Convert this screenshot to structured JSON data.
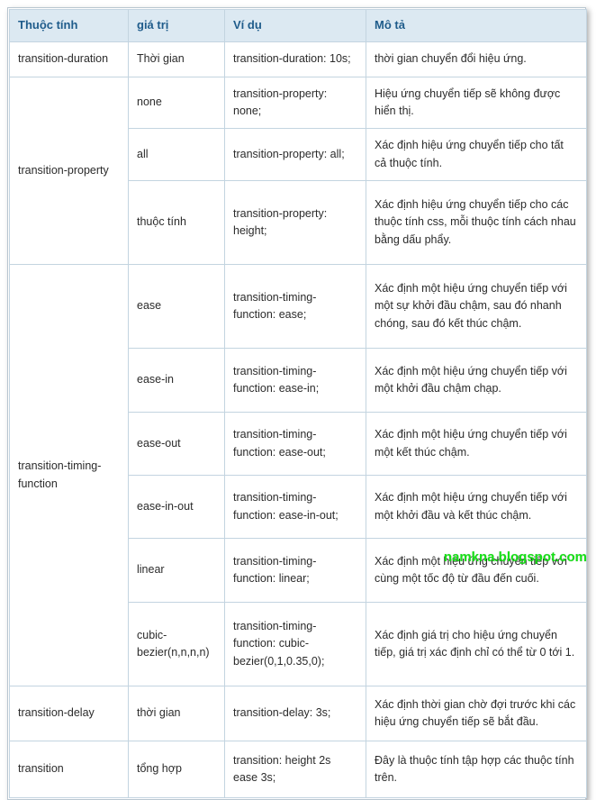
{
  "table": {
    "headers": [
      {
        "label": "Thuộc tính"
      },
      {
        "label": "giá trị"
      },
      {
        "label": "Ví dụ"
      },
      {
        "label": "Mô tả"
      }
    ],
    "rows": [
      {
        "property": "transition-duration",
        "value": "Thời gian",
        "example": "transition-duration: 10s;",
        "description": "thời gian chuyển đổi hiệu ứng."
      },
      {
        "property": "transition-property",
        "value": "none",
        "example": "transition-property: none;",
        "description": "Hiệu ứng chuyển tiếp sẽ không được hiển thị."
      },
      {
        "property": "",
        "value": "all",
        "example": "transition-property: all;",
        "description": "Xác định hiệu ứng chuyển tiếp cho tất cả thuộc tính."
      },
      {
        "property": "",
        "value": "thuộc tính",
        "example": "transition-property: height;",
        "description": "Xác định hiệu ứng chuyển tiếp cho các thuộc tính css, mỗi thuộc tính cách nhau bằng dấu phẩy."
      },
      {
        "property": "transition-timing-function",
        "value": "ease",
        "example": "transition-timing-function: ease;",
        "description": "Xác định một hiệu ứng chuyển tiếp với một sự khởi đầu chậm, sau đó nhanh chóng, sau đó kết thúc chậm."
      },
      {
        "property": "",
        "value": "ease-in",
        "example": "transition-timing-function: ease-in;",
        "description": "Xác định một hiệu ứng chuyển tiếp với một khởi đầu chậm chạp."
      },
      {
        "property": "",
        "value": "ease-out",
        "example": "transition-timing-function: ease-out;",
        "description": "Xác định một hiệu ứng chuyển tiếp với một kết thúc chậm."
      },
      {
        "property": "",
        "value": "ease-in-out",
        "example": "transition-timing-function: ease-in-out;",
        "description": "Xác định một hiệu ứng chuyển tiếp với một khởi đầu và kết thúc chậm."
      },
      {
        "property": "",
        "value": "linear",
        "example": "transition-timing-function: linear;",
        "description": "Xác định một hiệu ứng chuyển tiếp với cùng một tốc độ từ đầu đến cuối."
      },
      {
        "property": "",
        "value": "cubic-bezier(n,n,n,n)",
        "example": "transition-timing-function: cubic-bezier(0,1,0.35,0);",
        "description": "Xác định giá trị cho hiệu ứng chuyển tiếp, giá trị xác định chỉ có thể từ 0 tới 1."
      },
      {
        "property": "transition-delay",
        "value": "thời gian",
        "example": "transition-delay: 3s;",
        "description": "Xác định thời gian chờ đợi trước khi các hiệu ứng chuyển tiếp sẽ bắt đầu."
      },
      {
        "property": "transition",
        "value": "tổng hợp",
        "example": "transition: height 2s ease 3s;",
        "description": "Đây là thuộc tính tập hợp các thuộc tính trên."
      }
    ],
    "rowspan_labels": {
      "transition_property": "transition-property",
      "transition_timing_function": "transition-timing-function"
    }
  },
  "watermark": {
    "text": "namkna.blogspot.com"
  },
  "colors": {
    "header_bg": "#dce9f2",
    "header_text": "#1f5c8b",
    "cell_border": "#c3d4e0",
    "frame_border": "#b9c6d0",
    "body_text": "#2b2b2b",
    "watermark": "#16e016"
  }
}
